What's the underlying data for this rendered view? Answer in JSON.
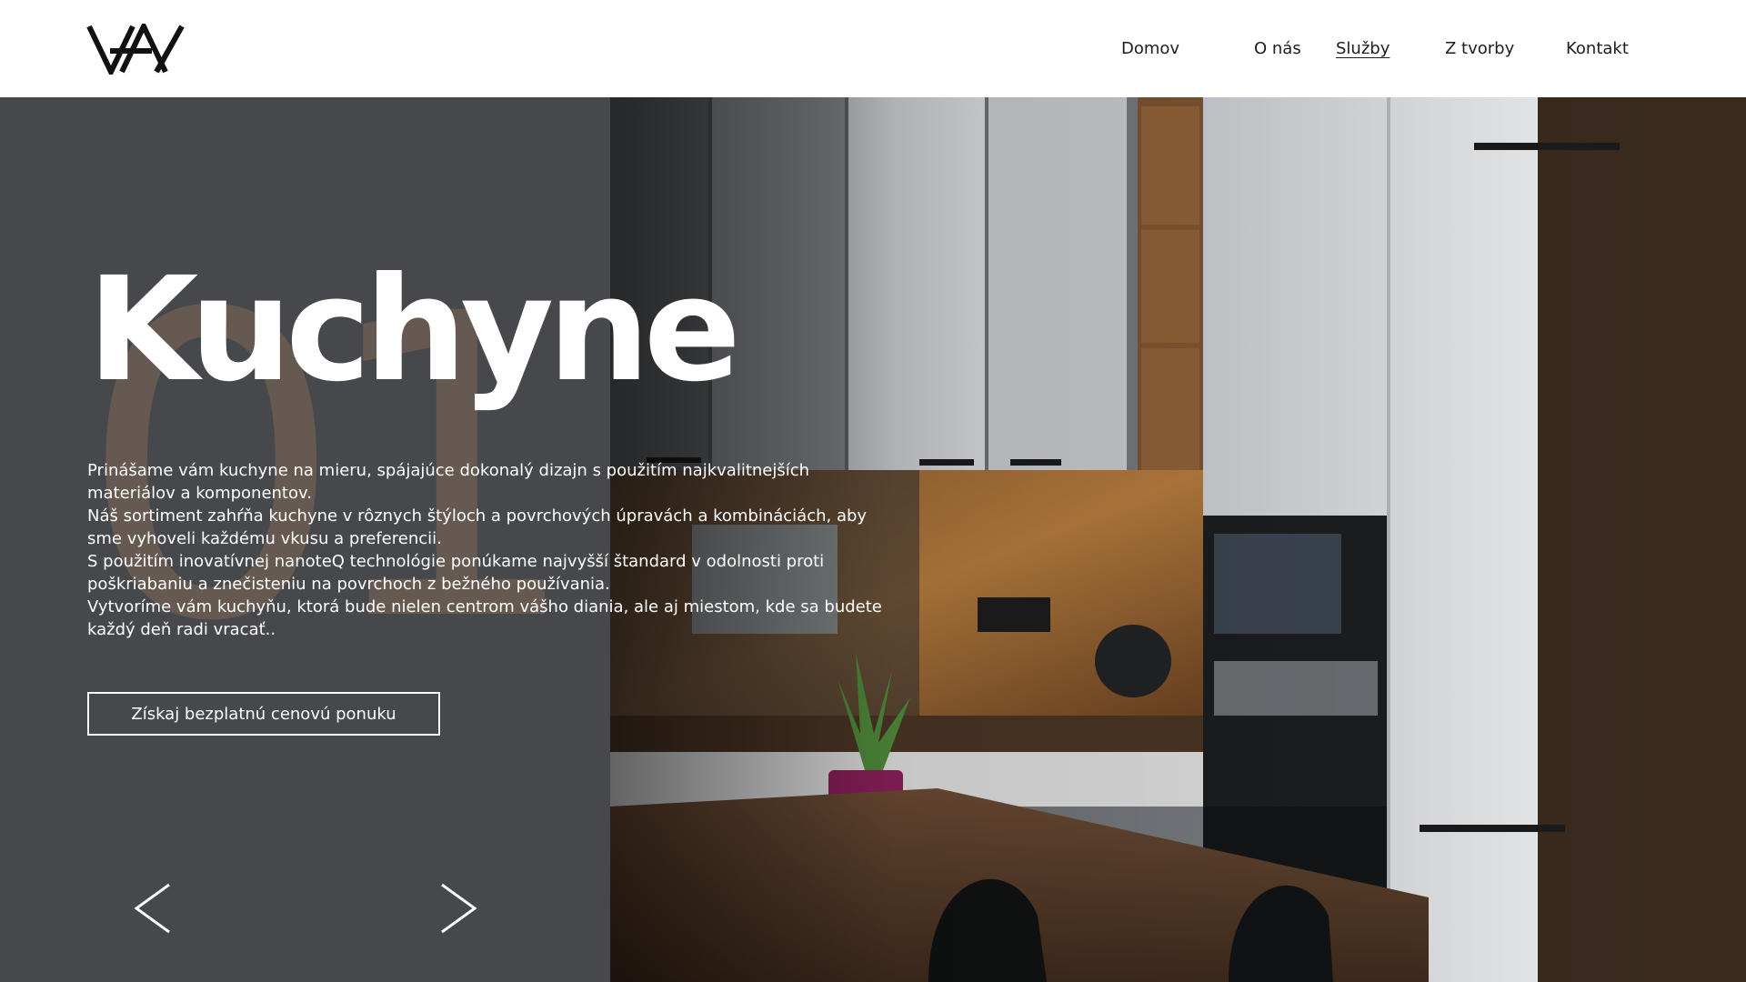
{
  "brand": {
    "logo_icon": "vav-monogram-logo"
  },
  "nav": {
    "items": [
      {
        "label": "Domov",
        "active": false
      },
      {
        "label": "O nás",
        "active": false
      },
      {
        "label": "Služby",
        "active": true
      },
      {
        "label": "Z tvorby",
        "active": false
      },
      {
        "label": "Kontakt",
        "active": false
      }
    ]
  },
  "hero": {
    "slide_number": "01",
    "title": "Kuchyne",
    "paragraphs": [
      "Prinášame vám kuchyne na mieru, spájajúce dokonalý dizajn s použitím najkvalitnejších materiálov a komponentov.",
      "Náš sortiment zahŕňa kuchyne v rôznych štýloch a povrchových úpravách a kombináciách, aby sme vyhoveli každému vkusu a preferencii.",
      "S použitím inovatívnej nanoteQ technológie ponúkame najvyšší štandard v odolnosti proti poškriabaniu a znečisteniu na povrchoch z bežného používania.",
      "Vytvoríme vám kuchyňu, ktorá bude nielen centrom vášho diania, ale aj miestom, kde sa budete každý deň radi vracať.."
    ],
    "cta_label": "Získaj bezplatnú cenovú ponuku",
    "prev_icon": "chevron-left-icon",
    "next_icon": "chevron-right-icon"
  },
  "colors": {
    "panel_bg": "#46484b",
    "number_watermark": "#98765c",
    "text": "#ffffff",
    "nav_text": "#1d1d1f"
  }
}
